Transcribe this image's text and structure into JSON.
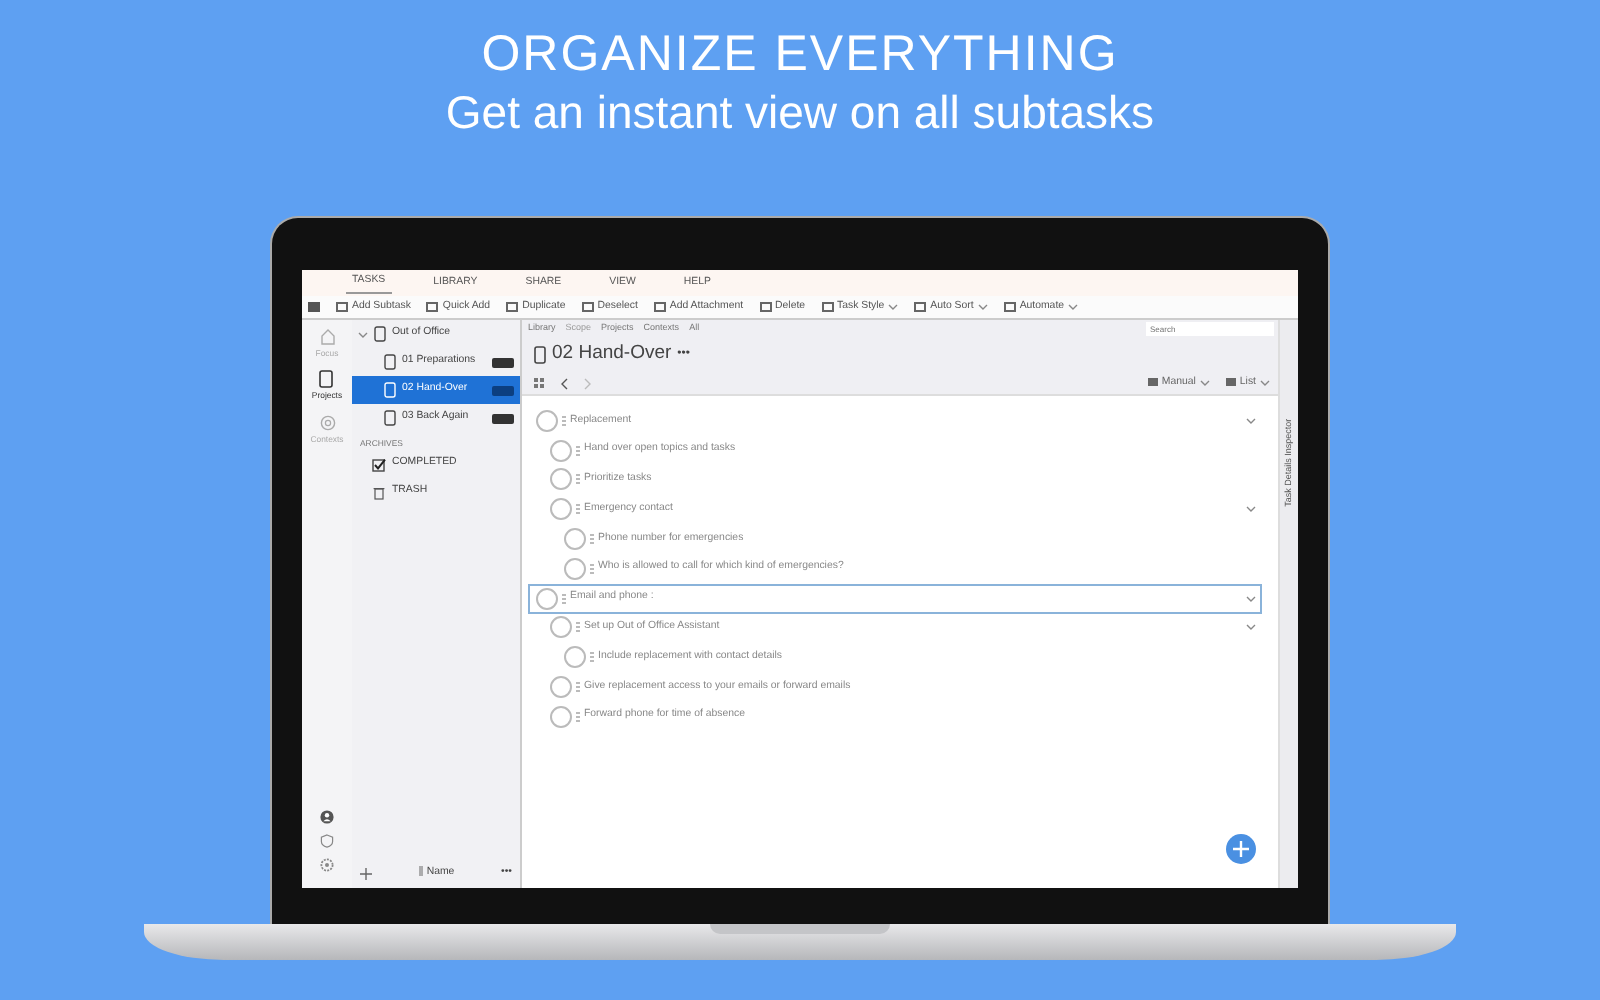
{
  "headline": "ORGANIZE EVERYTHING",
  "subheadline": "Get an instant view on all subtasks",
  "menu_tabs": [
    {
      "label": "TASKS",
      "selected": true
    },
    {
      "label": "LIBRARY",
      "selected": false
    },
    {
      "label": "SHARE",
      "selected": false
    },
    {
      "label": "VIEW",
      "selected": false
    },
    {
      "label": "HELP",
      "selected": false
    }
  ],
  "toolbar": [
    {
      "label": "Add Subtask",
      "dropdown": false
    },
    {
      "label": "Quick Add",
      "dropdown": false
    },
    {
      "label": "Duplicate",
      "dropdown": false
    },
    {
      "label": "Deselect",
      "dropdown": false
    },
    {
      "label": "Add Attachment",
      "dropdown": false
    },
    {
      "label": "Delete",
      "dropdown": false
    },
    {
      "label": "Task Style",
      "dropdown": true
    },
    {
      "label": "Auto Sort",
      "dropdown": true
    },
    {
      "label": "Automate",
      "dropdown": true
    }
  ],
  "modes": [
    {
      "label": "Focus",
      "selected": false
    },
    {
      "label": "Projects",
      "selected": true
    },
    {
      "label": "Contexts",
      "selected": false
    }
  ],
  "sidebar": {
    "projects": [
      {
        "label": "Out of Office",
        "expanded": true,
        "children": [
          {
            "label": "01 Preparations",
            "selected": false
          },
          {
            "label": "02 Hand-Over",
            "selected": true
          },
          {
            "label": "03 Back Again",
            "selected": false
          }
        ]
      }
    ],
    "archives_heading": "ARCHIVES",
    "archives": [
      "COMPLETED",
      "TRASH"
    ],
    "sort_label": "Name",
    "more": "•••"
  },
  "breadcrumbs": [
    {
      "label": "Library",
      "disabled": false
    },
    {
      "label": "Scope",
      "disabled": true
    },
    {
      "label": "Projects",
      "disabled": false
    },
    {
      "label": "Contexts",
      "disabled": false
    },
    {
      "label": "All",
      "disabled": false
    }
  ],
  "search": {
    "placeholder": "Search"
  },
  "title": "02 Hand-Over",
  "title_more": "•••",
  "view": {
    "sort": "Manual",
    "layout": "List"
  },
  "tasks": [
    {
      "label": "Replacement",
      "selected": false,
      "expanded": true,
      "children": [
        {
          "label": "Hand over open topics and tasks",
          "selected": false
        },
        {
          "label": "Prioritize tasks",
          "selected": false
        },
        {
          "label": "Emergency contact",
          "selected": false,
          "expanded": true,
          "children": [
            {
              "label": "Phone number for emergencies",
              "selected": false
            },
            {
              "label": "Who is allowed to call for which kind of emergencies?",
              "selected": false
            }
          ]
        }
      ]
    },
    {
      "label": "Email and phone :",
      "selected": true,
      "expanded": true,
      "children": [
        {
          "label": "Set up Out of Office Assistant",
          "selected": false,
          "expanded": true,
          "children": [
            {
              "label": "Include replacement with contact details",
              "selected": false
            }
          ]
        },
        {
          "label": "Give replacement access to your emails or forward emails",
          "selected": false
        },
        {
          "label": "Forward phone for time of absence",
          "selected": false
        }
      ]
    }
  ],
  "inspector_label": "Task Details Inspector"
}
